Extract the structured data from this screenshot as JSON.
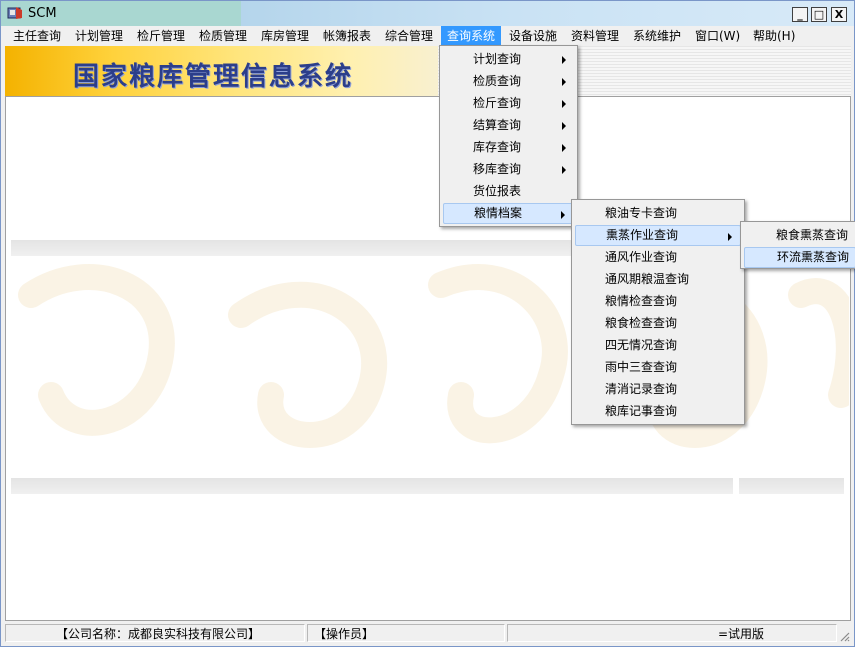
{
  "window": {
    "title": "SCM",
    "controls": {
      "minimize": "_",
      "maximize": "□",
      "close": "X"
    }
  },
  "menubar": {
    "items": [
      "主任查询",
      "计划管理",
      "检斤管理",
      "检质管理",
      "库房管理",
      "帐簿报表",
      "综合管理",
      "查询系统",
      "设备设施",
      "资料管理",
      "系统维护",
      "窗口(W)",
      "帮助(H)"
    ],
    "active_index": 7
  },
  "banner": {
    "title": "国家粮库管理信息系统"
  },
  "menu_query": {
    "items": [
      {
        "label": "计划查询",
        "submenu": true
      },
      {
        "label": "检质查询",
        "submenu": true
      },
      {
        "label": "检斤查询",
        "submenu": true
      },
      {
        "label": "结算查询",
        "submenu": true
      },
      {
        "label": "库存查询",
        "submenu": true
      },
      {
        "label": "移库查询",
        "submenu": true
      },
      {
        "label": "货位报表",
        "submenu": false
      },
      {
        "label": "粮情档案",
        "submenu": true
      }
    ],
    "highlight_index": 7
  },
  "menu_grain": {
    "items": [
      {
        "label": "粮油专卡查询",
        "submenu": false
      },
      {
        "label": "熏蒸作业查询",
        "submenu": true
      },
      {
        "label": "通风作业查询",
        "submenu": false
      },
      {
        "label": "通风期粮温查询",
        "submenu": false
      },
      {
        "label": "粮情检查查询",
        "submenu": false
      },
      {
        "label": "粮食检查查询",
        "submenu": false
      },
      {
        "label": "四无情况查询",
        "submenu": false
      },
      {
        "label": "雨中三查查询",
        "submenu": false
      },
      {
        "label": "清消记录查询",
        "submenu": false
      },
      {
        "label": "粮库记事查询",
        "submenu": false
      }
    ],
    "highlight_index": 1
  },
  "menu_fumigation": {
    "items": [
      {
        "label": "粮食熏蒸查询"
      },
      {
        "label": "环流熏蒸查询"
      }
    ],
    "highlight_index": 1
  },
  "statusbar": {
    "company": "【公司名称：成都良实科技有限公司】",
    "operator": "【操作员】",
    "version": "=试用版"
  },
  "colors": {
    "menu_active": "#3399ff",
    "item_highlight": "#d6e8ff",
    "banner": "#ffd23c",
    "banner_text": "#2c3e8a"
  }
}
